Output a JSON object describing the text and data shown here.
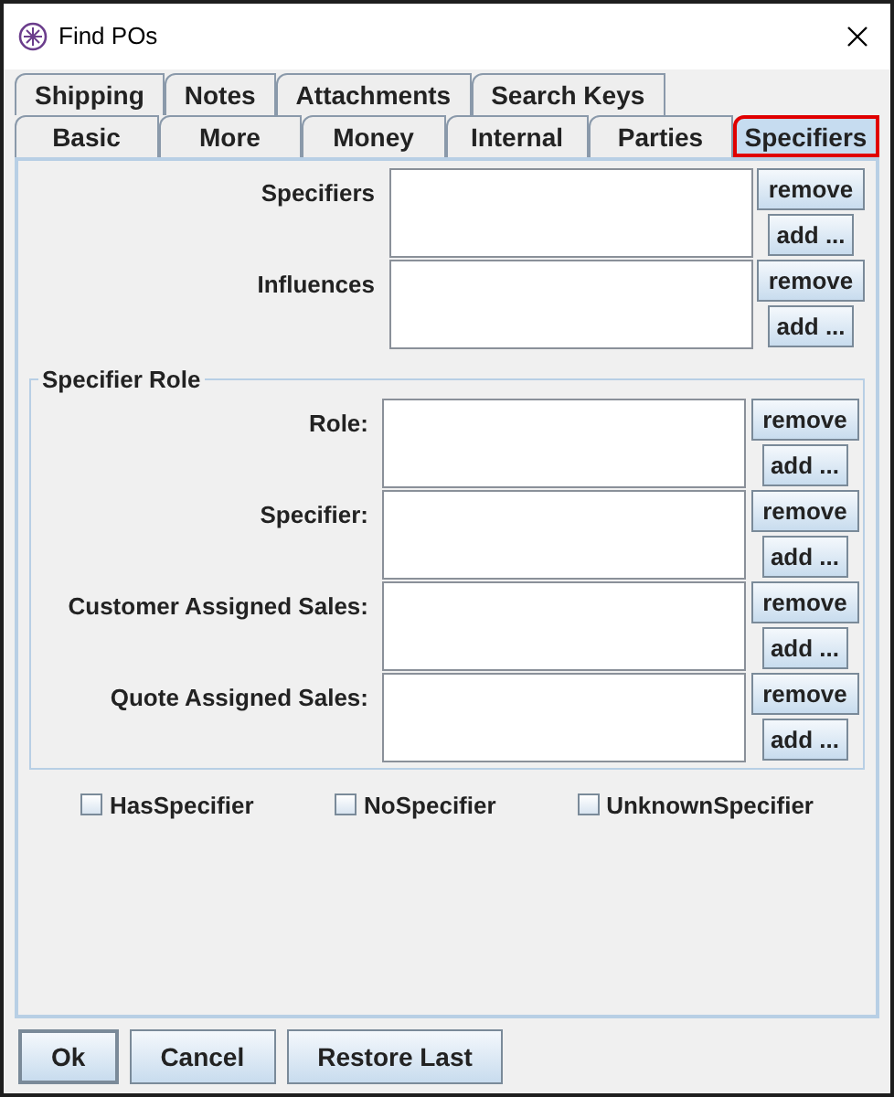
{
  "window": {
    "title": "Find POs"
  },
  "tab_rows": [
    [
      {
        "label": "Shipping",
        "selected": false
      },
      {
        "label": "Notes",
        "selected": false
      },
      {
        "label": "Attachments",
        "selected": false
      },
      {
        "label": "Search Keys",
        "selected": false
      }
    ],
    [
      {
        "label": "Basic",
        "selected": false
      },
      {
        "label": "More",
        "selected": false
      },
      {
        "label": "Money",
        "selected": false
      },
      {
        "label": "Internal",
        "selected": false
      },
      {
        "label": "Parties",
        "selected": false
      },
      {
        "label": "Specifiers",
        "selected": true
      }
    ]
  ],
  "fields": [
    {
      "label": "Specifiers",
      "remove": "remove",
      "add": "add ..."
    },
    {
      "label": "Influences",
      "remove": "remove",
      "add": "add ..."
    }
  ],
  "specifier_role": {
    "title": "Specifier Role",
    "fields": [
      {
        "label": "Role:",
        "remove": "remove",
        "add": "add ..."
      },
      {
        "label": "Specifier:",
        "remove": "remove",
        "add": "add ..."
      },
      {
        "label": "Customer Assigned Sales:",
        "remove": "remove",
        "add": "add ..."
      },
      {
        "label": "Quote Assigned Sales:",
        "remove": "remove",
        "add": "add ..."
      }
    ]
  },
  "checkboxes": [
    {
      "label": "HasSpecifier",
      "checked": false
    },
    {
      "label": "NoSpecifier",
      "checked": false
    },
    {
      "label": "UnknownSpecifier",
      "checked": false
    }
  ],
  "buttons": [
    {
      "label": "Ok",
      "default": true
    },
    {
      "label": "Cancel",
      "default": false
    },
    {
      "label": "Restore Last",
      "default": false
    }
  ]
}
